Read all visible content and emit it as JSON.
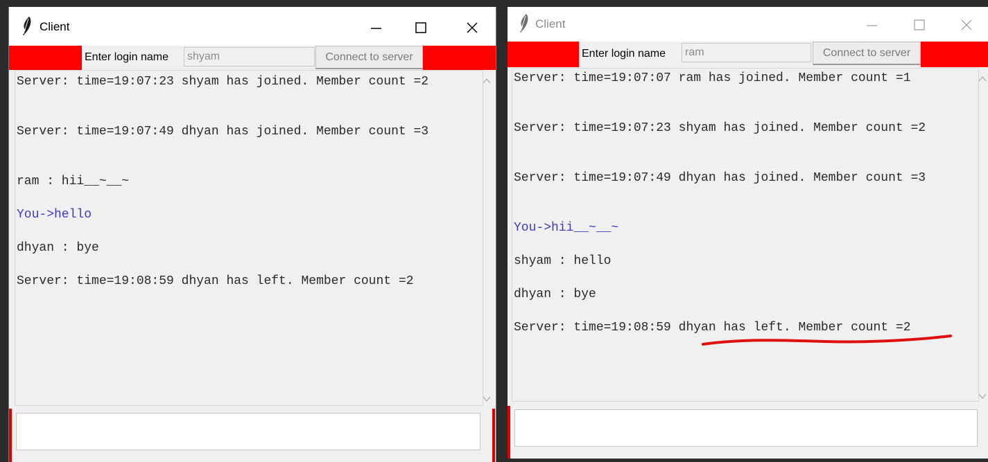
{
  "windows": [
    {
      "title": "Client",
      "login_label": "Enter login name",
      "login_value": "shyam",
      "connect_label": "Connect to server",
      "messages": [
        {
          "text": "Server: time=19:07:23 shyam has joined. Member count =2",
          "kind": "server"
        },
        {
          "text": "Server: time=19:07:49 dhyan has joined. Member count =3",
          "kind": "server"
        },
        {
          "text": "ram : hii__~__~",
          "kind": "other"
        },
        {
          "text": "You->hello",
          "kind": "you"
        },
        {
          "text": "dhyan : bye",
          "kind": "other"
        },
        {
          "text": "Server: time=19:08:59 dhyan has left. Member count =2",
          "kind": "server"
        }
      ],
      "message_value": ""
    },
    {
      "title": "Client",
      "login_label": "Enter login name",
      "login_value": "ram",
      "connect_label": "Connect to server",
      "messages": [
        {
          "text": "Server: time=19:07:07 ram has joined. Member count =1",
          "kind": "server"
        },
        {
          "text": "Server: time=19:07:23 shyam has joined. Member count =2",
          "kind": "server"
        },
        {
          "text": "Server: time=19:07:49 dhyan has joined. Member count =3",
          "kind": "server"
        },
        {
          "text": "You->hii__~__~",
          "kind": "you"
        },
        {
          "text": "shyam : hello",
          "kind": "other"
        },
        {
          "text": "dhyan : bye",
          "kind": "other"
        },
        {
          "text": "Server: time=19:08:59 dhyan has left. Member count =2",
          "kind": "server"
        }
      ],
      "message_value": ""
    }
  ],
  "colors": {
    "toolbar_red": "#ff0000",
    "you_message_blue": "#3a3ac8",
    "annotation_red": "#e01010"
  }
}
